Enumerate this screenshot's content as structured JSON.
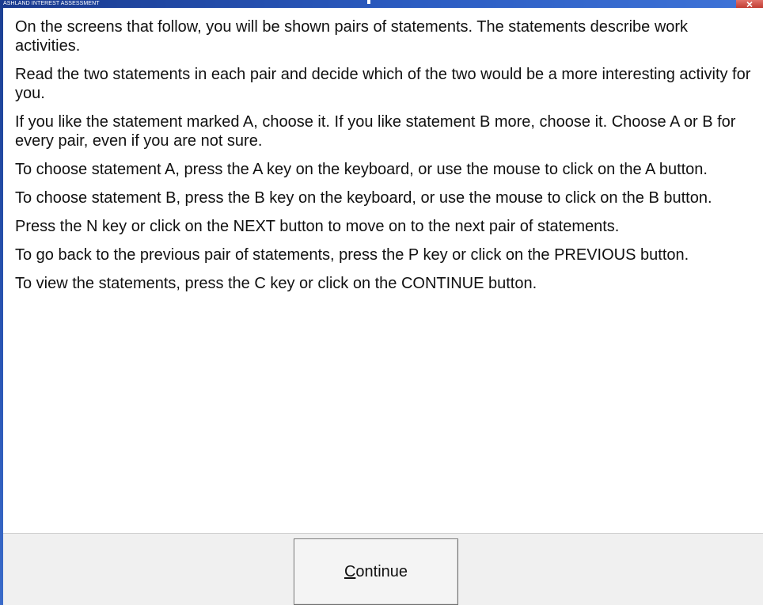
{
  "window": {
    "title": "ASHLAND INTEREST ASSESSMENT",
    "close_icon": "close-icon",
    "titlebar_color": "#2b5cc2",
    "close_color": "#c13d33"
  },
  "instructions": [
    "On the screens that follow, you will be shown pairs of statements. The statements describe work activities.",
    "Read the two statements in each pair and decide which of the two would be a more interesting activity for you.",
    "If you like the statement marked A, choose it. If you like statement B more, choose it. Choose A or B for every pair, even if you are not sure.",
    "To choose statement A, press the A key on the keyboard, or use the mouse to click on the A button.",
    "To choose statement B, press the B key on the keyboard, or use the mouse to click on the B button.",
    "Press the N key or click on the NEXT button to move on to the next pair of statements.",
    "To go back to the previous pair of statements, press the P key or click on the PREVIOUS button.",
    "To view the statements, press the C key or click on the CONTINUE button."
  ],
  "footer": {
    "continue_mnemonic": "C",
    "continue_rest": "ontinue"
  }
}
